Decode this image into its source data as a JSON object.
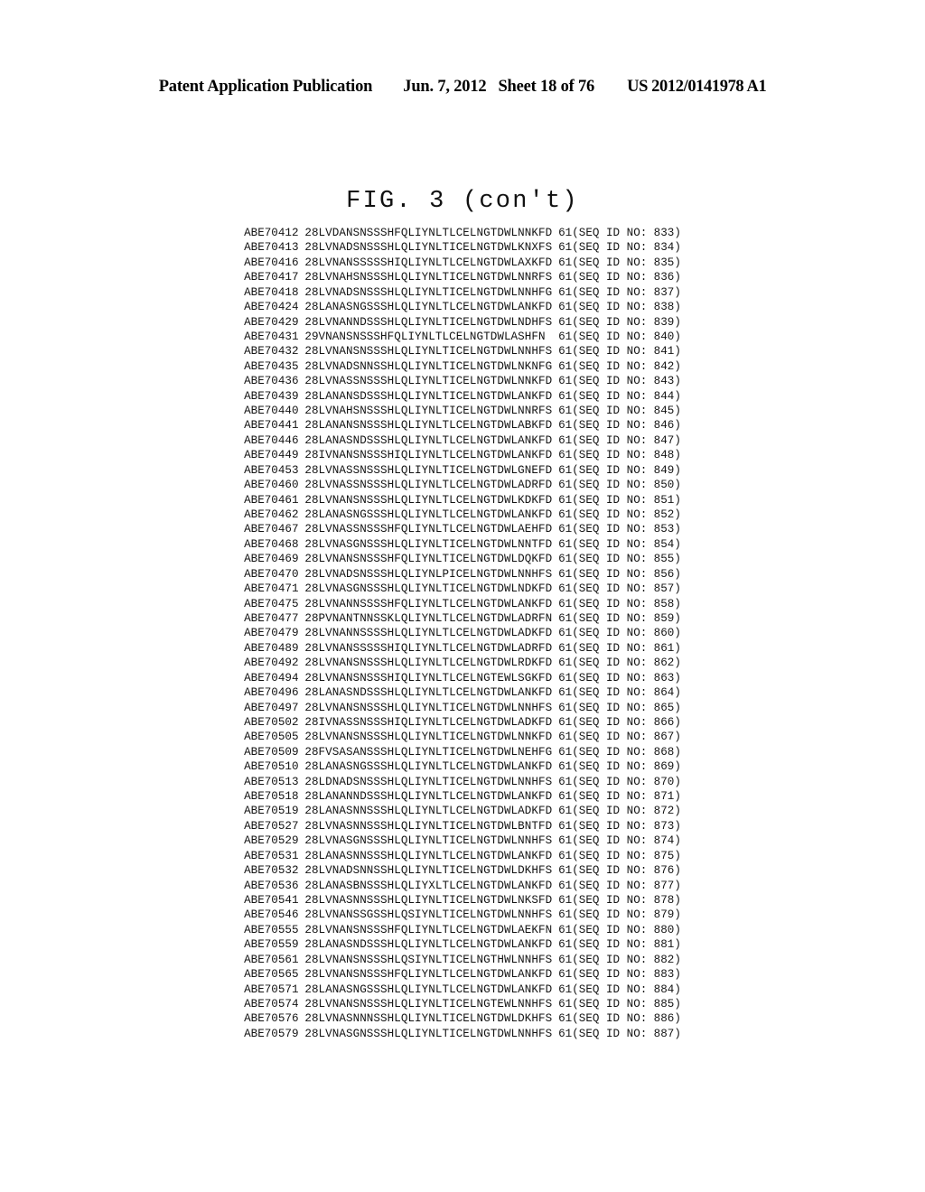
{
  "header": {
    "publication": "Patent Application Publication",
    "date": "Jun. 7, 2012",
    "sheet": "Sheet 18 of 76",
    "doc_number": "US 2012/0141978 A1"
  },
  "figure": {
    "title": "FIG. 3 (con't)",
    "seq_id_label": "(SEQ ID NO:",
    "seq_id_close": ")"
  },
  "rows": [
    {
      "id": "ABE70412",
      "start": "28",
      "seq": "LVDANSNSSSHFQLIYNLTLCELNGTDWLNNKFD",
      "end": "61",
      "seqid": "833",
      "indent": false
    },
    {
      "id": "ABE70413",
      "start": "28",
      "seq": "LVNADSNSSSHLQLIYNLTICELNGTDWLKNXFS",
      "end": "61",
      "seqid": "834",
      "indent": false
    },
    {
      "id": "ABE70416",
      "start": "28",
      "seq": "LVNANSSSSSHIQLIYNLTLCELNGTDWLAXKFD",
      "end": "61",
      "seqid": "835",
      "indent": false
    },
    {
      "id": "ABE70417",
      "start": "28",
      "seq": "LVNAHSNSSSHLQLIYNLTICELNGTDWLNNRFS",
      "end": "61",
      "seqid": "836",
      "indent": false
    },
    {
      "id": "ABE70418",
      "start": "28",
      "seq": "LVNADSNSSSHLQLIYNLTICELNGTDWLNNHFG",
      "end": "61",
      "seqid": "837",
      "indent": false
    },
    {
      "id": "ABE70424",
      "start": "28",
      "seq": "LANASNGSSSHLQLIYNLTLCELNGTDWLANKFD",
      "end": "61",
      "seqid": "838",
      "indent": false
    },
    {
      "id": "ABE70429",
      "start": "28",
      "seq": "LVNANNDSSSHLQLIYNLTICELNGTDWLNDHFS",
      "end": "61",
      "seqid": "839",
      "indent": false
    },
    {
      "id": "ABE70431",
      "start": "29",
      "seq": "VNANSNSSSHFQLIYNLTLCELNGTDWLASHFN",
      "end": "61",
      "seqid": "840",
      "indent": true
    },
    {
      "id": "ABE70432",
      "start": "28",
      "seq": "LVNANSNSSSHLQLIYNLTICELNGTDWLNNHFS",
      "end": "61",
      "seqid": "841",
      "indent": false
    },
    {
      "id": "ABE70435",
      "start": "28",
      "seq": "LVNADSNNSSHLQLIYNLTICELNGTDWLNKNFG",
      "end": "61",
      "seqid": "842",
      "indent": false
    },
    {
      "id": "ABE70436",
      "start": "28",
      "seq": "LVNASSNSSSHLQLIYNLTICELNGTDWLNNKFD",
      "end": "61",
      "seqid": "843",
      "indent": false
    },
    {
      "id": "ABE70439",
      "start": "28",
      "seq": "LANANSDSSSHLQLIYNLTICELNGTDWLANKFD",
      "end": "61",
      "seqid": "844",
      "indent": false
    },
    {
      "id": "ABE70440",
      "start": "28",
      "seq": "LVNAHSNSSSHLQLIYNLTICELNGTDWLNNRFS",
      "end": "61",
      "seqid": "845",
      "indent": false
    },
    {
      "id": "ABE70441",
      "start": "28",
      "seq": "LANANSNSSSHLQLIYNLTLCELNGTDWLABKFD",
      "end": "61",
      "seqid": "846",
      "indent": false
    },
    {
      "id": "ABE70446",
      "start": "28",
      "seq": "LANASNDSSSHLQLIYNLTLCELNGTDWLANKFD",
      "end": "61",
      "seqid": "847",
      "indent": false
    },
    {
      "id": "ABE70449",
      "start": "28",
      "seq": "IVNANSNSSSHIQLIYNLTLCELNGTDWLANKFD",
      "end": "61",
      "seqid": "848",
      "indent": false
    },
    {
      "id": "ABE70453",
      "start": "28",
      "seq": "LVNASSNSSSHLQLIYNLTICELNGTDWLGNEFD",
      "end": "61",
      "seqid": "849",
      "indent": false
    },
    {
      "id": "ABE70460",
      "start": "28",
      "seq": "LVNASSNSSSHLQLIYNLTLCELNGTDWLADRFD",
      "end": "61",
      "seqid": "850",
      "indent": false
    },
    {
      "id": "ABE70461",
      "start": "28",
      "seq": "LVNANSNSSSHLQLIYNLTLCELNGTDWLKDKFD",
      "end": "61",
      "seqid": "851",
      "indent": false
    },
    {
      "id": "ABE70462",
      "start": "28",
      "seq": "LANASNGSSSHLQLIYNLTLCELNGTDWLANKFD",
      "end": "61",
      "seqid": "852",
      "indent": false
    },
    {
      "id": "ABE70467",
      "start": "28",
      "seq": "LVNASSNSSSHFQLIYNLTLCELNGTDWLAEHFD",
      "end": "61",
      "seqid": "853",
      "indent": false
    },
    {
      "id": "ABE70468",
      "start": "28",
      "seq": "LVNASGNSSSHLQLIYNLTICELNGTDWLNNTFD",
      "end": "61",
      "seqid": "854",
      "indent": false
    },
    {
      "id": "ABE70469",
      "start": "28",
      "seq": "LVNANSNSSSHFQLIYNLTICELNGTDWLDQKFD",
      "end": "61",
      "seqid": "855",
      "indent": false
    },
    {
      "id": "ABE70470",
      "start": "28",
      "seq": "LVNADSNSSSHLQLIYNLPICELNGTDWLNNHFS",
      "end": "61",
      "seqid": "856",
      "indent": false
    },
    {
      "id": "ABE70471",
      "start": "28",
      "seq": "LVNASGNSSSHLQLIYNLTICELNGTDWLNDKFD",
      "end": "61",
      "seqid": "857",
      "indent": false
    },
    {
      "id": "ABE70475",
      "start": "28",
      "seq": "LVNANNSSSSHFQLIYNLTLCELNGTDWLANKFD",
      "end": "61",
      "seqid": "858",
      "indent": false
    },
    {
      "id": "ABE70477",
      "start": "28",
      "seq": "PVNANTNNSSKLQLIYNLTLCELNGTDWLADRFN",
      "end": "61",
      "seqid": "859",
      "indent": false
    },
    {
      "id": "ABE70479",
      "start": "28",
      "seq": "LVNANNSSSSHLQLIYNLTLCELNGTDWLADKFD",
      "end": "61",
      "seqid": "860",
      "indent": false
    },
    {
      "id": "ABE70489",
      "start": "28",
      "seq": "LVNANSSSSSHIQLIYNLTLCELNGTDWLADRFD",
      "end": "61",
      "seqid": "861",
      "indent": false
    },
    {
      "id": "ABE70492",
      "start": "28",
      "seq": "LVNANSNSSSHLQLIYNLTLCELNGTDWLRDKFD",
      "end": "61",
      "seqid": "862",
      "indent": false
    },
    {
      "id": "ABE70494",
      "start": "28",
      "seq": "LVNANSNSSSHIQLIYNLTLCELNGTEWLSGKFD",
      "end": "61",
      "seqid": "863",
      "indent": false
    },
    {
      "id": "ABE70496",
      "start": "28",
      "seq": "LANASNDSSSHLQLIYNLTLCELNGTDWLANKFD",
      "end": "61",
      "seqid": "864",
      "indent": false
    },
    {
      "id": "ABE70497",
      "start": "28",
      "seq": "LVNANSNSSSHLQLIYNLTICELNGTDWLNNHFS",
      "end": "61",
      "seqid": "865",
      "indent": false
    },
    {
      "id": "ABE70502",
      "start": "28",
      "seq": "IVNASSNSSSHIQLIYNLTLCELNGTDWLADKFD",
      "end": "61",
      "seqid": "866",
      "indent": false
    },
    {
      "id": "ABE70505",
      "start": "28",
      "seq": "LVNANSNSSSHLQLIYNLTICELNGTDWLNNKFD",
      "end": "61",
      "seqid": "867",
      "indent": false
    },
    {
      "id": "ABE70509",
      "start": "28",
      "seq": "FVSASANSSSHLQLIYNLTICELNGTDWLNEHFG",
      "end": "61",
      "seqid": "868",
      "indent": false
    },
    {
      "id": "ABE70510",
      "start": "28",
      "seq": "LANASNGSSSHLQLIYNLTLCELNGTDWLANKFD",
      "end": "61",
      "seqid": "869",
      "indent": false
    },
    {
      "id": "ABE70513",
      "start": "28",
      "seq": "LDNADSNSSSHLQLIYNLTICELNGTDWLNNHFS",
      "end": "61",
      "seqid": "870",
      "indent": false
    },
    {
      "id": "ABE70518",
      "start": "28",
      "seq": "LANANNDSSSHLQLIYNLTLCELNGTDWLANKFD",
      "end": "61",
      "seqid": "871",
      "indent": false
    },
    {
      "id": "ABE70519",
      "start": "28",
      "seq": "LANASNNSSSHLQLIYNLTLCELNGTDWLADKFD",
      "end": "61",
      "seqid": "872",
      "indent": false
    },
    {
      "id": "ABE70527",
      "start": "28",
      "seq": "LVNASNNSSSHLQLIYNLTICELNGTDWLBNTFD",
      "end": "61",
      "seqid": "873",
      "indent": false
    },
    {
      "id": "ABE70529",
      "start": "28",
      "seq": "LVNASGNSSSHLQLIYNLTICELNGTDWLNNHFS",
      "end": "61",
      "seqid": "874",
      "indent": false
    },
    {
      "id": "ABE70531",
      "start": "28",
      "seq": "LANASNNSSSHLQLIYNLTLCELNGTDWLANKFD",
      "end": "61",
      "seqid": "875",
      "indent": false
    },
    {
      "id": "ABE70532",
      "start": "28",
      "seq": "LVNADSNNSSHLQLIYNLTICELNGTDWLDKHFS",
      "end": "61",
      "seqid": "876",
      "indent": false
    },
    {
      "id": "ABE70536",
      "start": "28",
      "seq": "LANASBNSSSHLQLIYXLTLCELNGTDWLANKFD",
      "end": "61",
      "seqid": "877",
      "indent": false
    },
    {
      "id": "ABE70541",
      "start": "28",
      "seq": "LVNASNNSSSHLQLIYNLTICELNGTDWLNKSFD",
      "end": "61",
      "seqid": "878",
      "indent": false
    },
    {
      "id": "ABE70546",
      "start": "28",
      "seq": "LVNANSSGSSHLQSIYNLTICELNGTDWLNNHFS",
      "end": "61",
      "seqid": "879",
      "indent": false
    },
    {
      "id": "ABE70555",
      "start": "28",
      "seq": "LVNANSNSSSHFQLIYNLTLCELNGTDWLAEKFN",
      "end": "61",
      "seqid": "880",
      "indent": false
    },
    {
      "id": "ABE70559",
      "start": "28",
      "seq": "LANASNDSSSHLQLIYNLTLCELNGTDWLANKFD",
      "end": "61",
      "seqid": "881",
      "indent": false
    },
    {
      "id": "ABE70561",
      "start": "28",
      "seq": "LVNANSNSSSHLQSIYNLTICELNGTHWLNNHFS",
      "end": "61",
      "seqid": "882",
      "indent": false
    },
    {
      "id": "ABE70565",
      "start": "28",
      "seq": "LVNANSNSSSHFQLIYNLTLCELNGTDWLANKFD",
      "end": "61",
      "seqid": "883",
      "indent": false
    },
    {
      "id": "ABE70571",
      "start": "28",
      "seq": "LANASNGSSSHLQLIYNLTLCELNGTDWLANKFD",
      "end": "61",
      "seqid": "884",
      "indent": false
    },
    {
      "id": "ABE70574",
      "start": "28",
      "seq": "LVNANSNSSSHLQLIYNLTICELNGTEWLNNHFS",
      "end": "61",
      "seqid": "885",
      "indent": false
    },
    {
      "id": "ABE70576",
      "start": "28",
      "seq": "LVNASNNNSSHLQLIYNLTICELNGTDWLDKHFS",
      "end": "61",
      "seqid": "886",
      "indent": false
    },
    {
      "id": "ABE70579",
      "start": "28",
      "seq": "LVNASGNSSSHLQLIYNLTICELNGTDWLNNHFS",
      "end": "61",
      "seqid": "887",
      "indent": false
    }
  ]
}
